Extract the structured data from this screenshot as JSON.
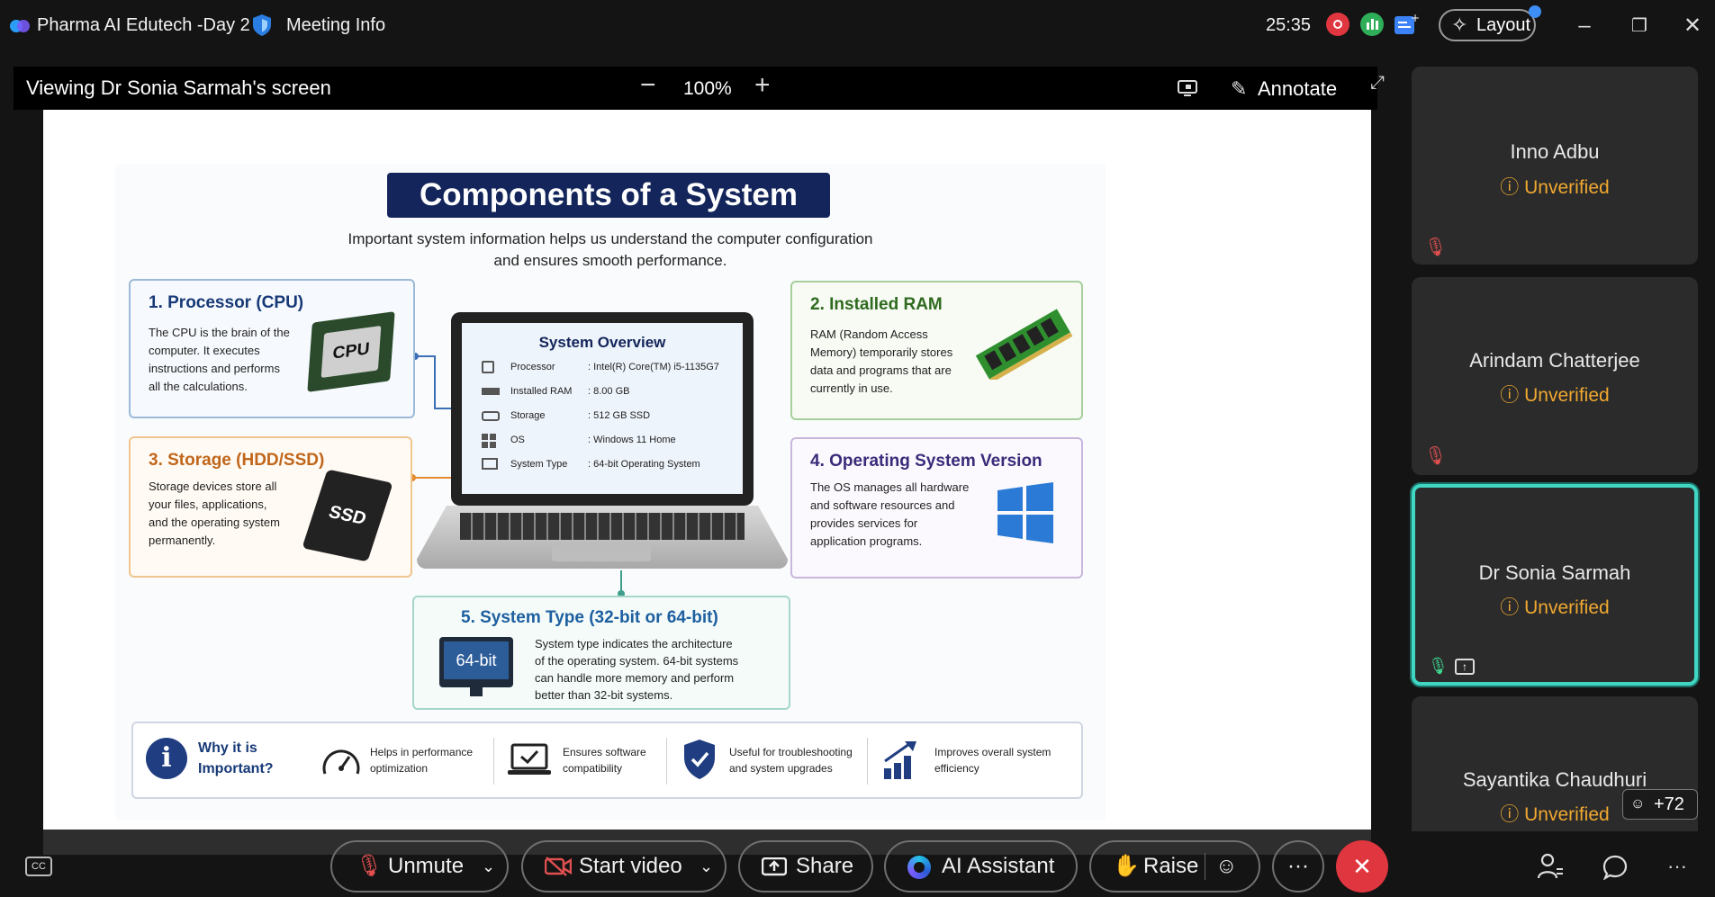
{
  "titlebar": {
    "app_name": "Pharma AI Edutech -Day 2",
    "meeting_info": "Meeting Info",
    "timer": "25:35",
    "layout_label": "Layout"
  },
  "share": {
    "viewing": "Viewing Dr Sonia Sarmah's screen",
    "zoom": "100%",
    "annotate": "Annotate"
  },
  "slide": {
    "title": "Components of a System",
    "subtitle_line1": "Important system information helps us understand the computer configuration",
    "subtitle_line2": "and ensures smooth performance.",
    "cpu": {
      "title": "1. Processor (CPU)",
      "text": [
        "The CPU is the brain of the",
        "computer. It executes",
        "instructions and performs",
        "all the calculations."
      ],
      "chip_label": "CPU"
    },
    "ram": {
      "title": "2. Installed RAM",
      "text": [
        "RAM (Random Access",
        "Memory) temporarily stores",
        "data and programs that are",
        "currently in use."
      ]
    },
    "storage": {
      "title": "3. Storage (HDD/SSD)",
      "text": [
        "Storage devices store all",
        "your files, applications,",
        "and the operating system",
        "permanently."
      ],
      "ssd_label": "SSD"
    },
    "os": {
      "title": "4. Operating System Version",
      "text": [
        "The OS manages all hardware",
        "and software resources and",
        "provides services for",
        "application programs."
      ]
    },
    "systype": {
      "title": "5. System Type (32-bit or 64-bit)",
      "text": [
        "System type indicates the architecture",
        "of the operating system. 64-bit systems",
        "can handle more memory and perform",
        "better than 32-bit systems."
      ],
      "monitor_label": "64-bit"
    },
    "overview": {
      "title": "System Overview",
      "rows": [
        {
          "label": "Processor",
          "value": ": Intel(R) Core(TM) i5-1135G7"
        },
        {
          "label": "Installed RAM",
          "value": ": 8.00 GB"
        },
        {
          "label": "Storage",
          "value": ": 512 GB SSD"
        },
        {
          "label": "OS",
          "value": ": Windows 11 Home"
        },
        {
          "label": "System Type",
          "value": ": 64-bit Operating System"
        }
      ]
    },
    "why": {
      "heading_line1": "Why it is",
      "heading_line2": "Important?",
      "items": [
        {
          "l1": "Helps in performance",
          "l2": "optimization"
        },
        {
          "l1": "Ensures software",
          "l2": "compatibility"
        },
        {
          "l1": "Useful for troubleshooting",
          "l2": "and system upgrades"
        },
        {
          "l1": "Improves overall system",
          "l2": "efficiency"
        }
      ]
    }
  },
  "participants": [
    {
      "name": "Inno Adbu",
      "status": "Unverified"
    },
    {
      "name": "Arindam Chatterjee",
      "status": "Unverified"
    },
    {
      "name": "Dr Sonia Sarmah",
      "status": "Unverified"
    },
    {
      "name": "Sayantika Chaudhuri",
      "status": "Unverified"
    }
  ],
  "more_count": "+72",
  "controls": {
    "unmute": "Unmute",
    "start_video": "Start video",
    "share": "Share",
    "ai_assistant": "AI Assistant",
    "raise": "Raise",
    "more": "···"
  }
}
